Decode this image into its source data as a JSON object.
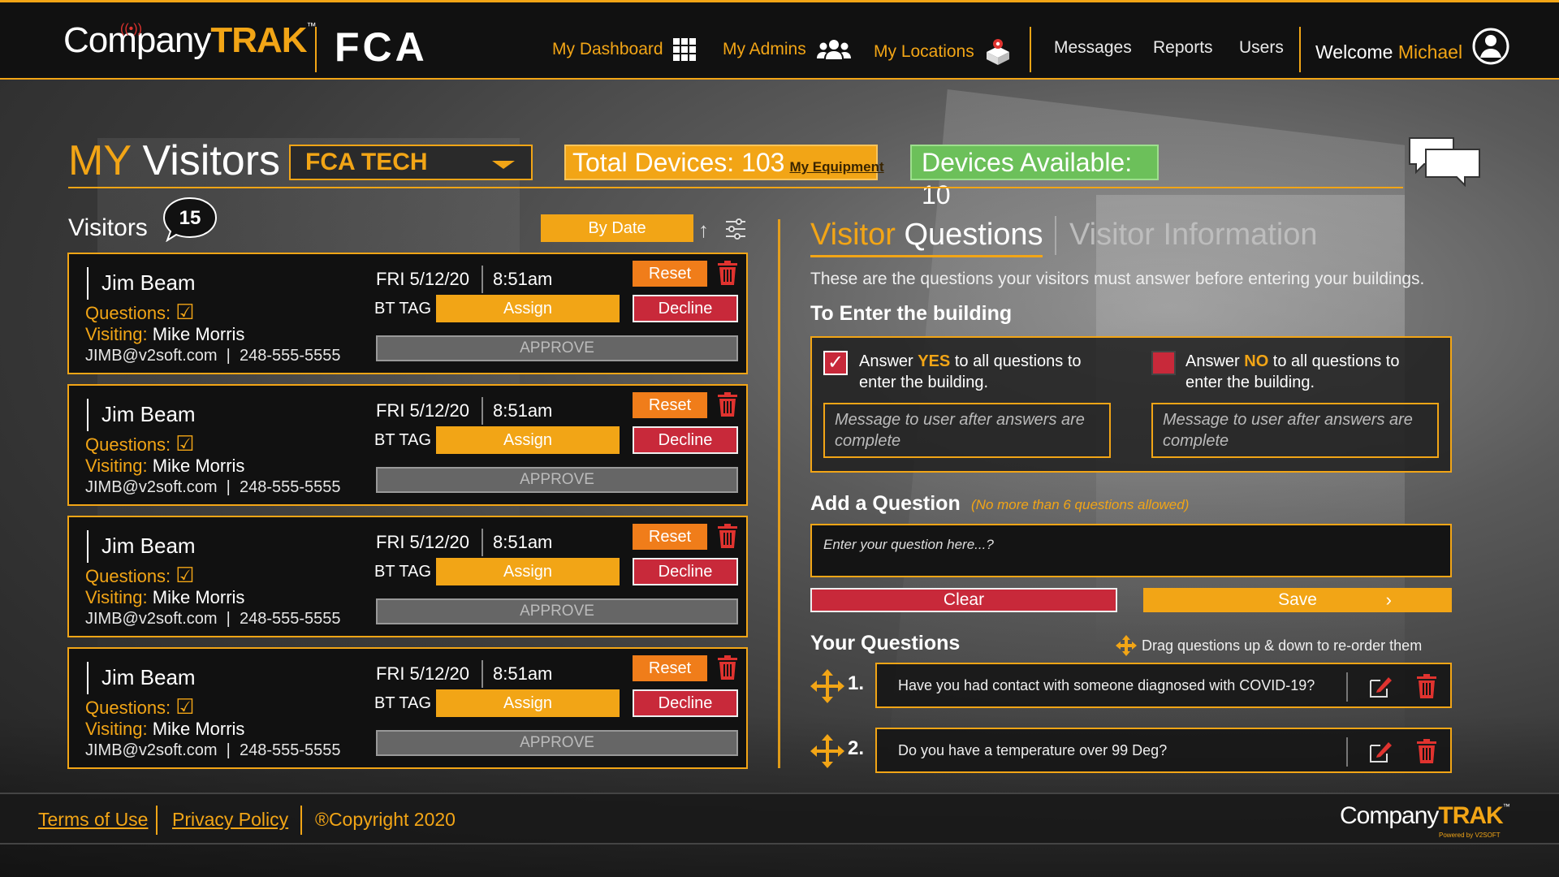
{
  "header": {
    "logo_company": "Company",
    "logo_trak": "TRAK",
    "logo_tm": "™",
    "partner_logo": "FCA",
    "nav": [
      {
        "label": "My Dashboard",
        "icon": "grid-icon"
      },
      {
        "label": "My Admins",
        "icon": "users-icon"
      },
      {
        "label": "My Locations",
        "icon": "location-cube-icon"
      },
      {
        "label": "Messages"
      },
      {
        "label": "Reports"
      },
      {
        "label": "Users"
      }
    ],
    "welcome_prefix": "Welcome",
    "welcome_name": "Michael"
  },
  "title": {
    "my": "MY",
    "rest": " Visitors"
  },
  "site_select": {
    "value": "FCA TECH"
  },
  "total_devices": {
    "label": "Total Devices: 103",
    "link": "My Equipment"
  },
  "devices_available": {
    "label": "Devices Available: 10"
  },
  "visitors": {
    "label": "Visitors",
    "count": "15",
    "sort_label": "By Date",
    "sort_glyph": "↑",
    "cards": [
      {
        "name": "Jim Beam",
        "questions_label": "Questions:",
        "check": "☑",
        "visiting_label": "Visiting:",
        "visiting_name": " Mike Morris",
        "email": "JIMB@v2soft.com",
        "phone": "248-555-5555",
        "date": "FRI 5/12/20",
        "time": "8:51am",
        "bt_tag": "BT TAG",
        "assign": "Assign",
        "reset": "Reset",
        "decline": "Decline",
        "approve": "APPROVE"
      },
      {
        "name": "Jim Beam",
        "questions_label": "Questions:",
        "check": "☑",
        "visiting_label": "Visiting:",
        "visiting_name": " Mike Morris",
        "email": "JIMB@v2soft.com",
        "phone": "248-555-5555",
        "date": "FRI 5/12/20",
        "time": "8:51am",
        "bt_tag": "BT TAG",
        "assign": "Assign",
        "reset": "Reset",
        "decline": "Decline",
        "approve": "APPROVE"
      },
      {
        "name": "Jim Beam",
        "questions_label": "Questions:",
        "check": "☑",
        "visiting_label": "Visiting:",
        "visiting_name": " Mike Morris",
        "email": "JIMB@v2soft.com",
        "phone": "248-555-5555",
        "date": "FRI 5/12/20",
        "time": "8:51am",
        "bt_tag": "BT TAG",
        "assign": "Assign",
        "reset": "Reset",
        "decline": "Decline",
        "approve": "APPROVE"
      },
      {
        "name": "Jim Beam",
        "questions_label": "Questions:",
        "check": "☑",
        "visiting_label": "Visiting:",
        "visiting_name": " Mike Morris",
        "email": "JIMB@v2soft.com",
        "phone": "248-555-5555",
        "date": "FRI 5/12/20",
        "time": "8:51am",
        "bt_tag": "BT TAG",
        "assign": "Assign",
        "reset": "Reset",
        "decline": "Decline",
        "approve": "APPROVE"
      }
    ]
  },
  "right": {
    "tab_active_hl": "Visitor",
    "tab_active_rest": " Questions",
    "tab_inactive": "Visitor Information",
    "intro": "These are the questions your visitors must answer before entering your buildings.",
    "enter_title": "To Enter the building",
    "yes_pre": "Answer ",
    "yes_kw": "YES",
    "yes_post": " to all questions to",
    "yes_line2": "enter the building.",
    "no_pre": "Answer ",
    "no_kw": "NO",
    "no_post": " to all questions to",
    "no_line2": "enter the building.",
    "yes_check": "✓",
    "msg_placeholder": "Message to user after answers are complete",
    "add_title": "Add a Question",
    "add_hint": "(No more than 6 questions allowed)",
    "question_placeholder": "Enter your question here...?",
    "clear": "Clear",
    "save": "Save",
    "save_chevron": "›",
    "your_title": "Your Questions",
    "drag_hint": "Drag questions up & down to re-order them",
    "questions": [
      {
        "num": "1.",
        "text": "Have you had contact with someone diagnosed with COVID-19?"
      },
      {
        "num": "2.",
        "text": "Do you have a temperature over 99 Deg?"
      }
    ]
  },
  "footer": {
    "terms": "Terms of Use",
    "privacy": "Privacy Policy",
    "copyright": "®Copyright 2020",
    "logo_company": "Company",
    "logo_trak": "TRAK",
    "logo_tm": "™",
    "powered": "Powered by V2SOFT"
  },
  "colors": {
    "accent": "#f2a516",
    "danger": "#c8293a",
    "success": "#6cc05a",
    "reset": "#f07d1a"
  }
}
